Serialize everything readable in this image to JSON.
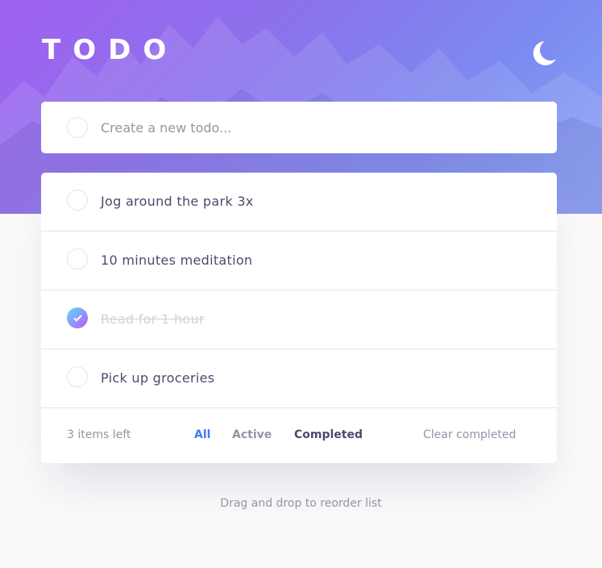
{
  "header": {
    "title": "TODO",
    "theme_icon": "moon-icon"
  },
  "new_todo": {
    "placeholder": "Create a new todo..."
  },
  "todos": [
    {
      "label": "Jog around the park 3x",
      "completed": false
    },
    {
      "label": "10 minutes meditation",
      "completed": false
    },
    {
      "label": "Read for 1 hour",
      "completed": true
    },
    {
      "label": "Pick up groceries",
      "completed": false
    }
  ],
  "footer": {
    "items_left": "3 items left",
    "filters": {
      "all": "All",
      "active": "Active",
      "completed": "Completed"
    },
    "selected_filter": "All",
    "clear_label": "Clear completed"
  },
  "hint": "Drag and drop to reorder list",
  "colors": {
    "accent": "#3a7cfd",
    "check_gradient": [
      "#55ddff",
      "#c058f3"
    ],
    "hero_gradient": [
      "#a061f0",
      "#8aa4f5"
    ]
  }
}
